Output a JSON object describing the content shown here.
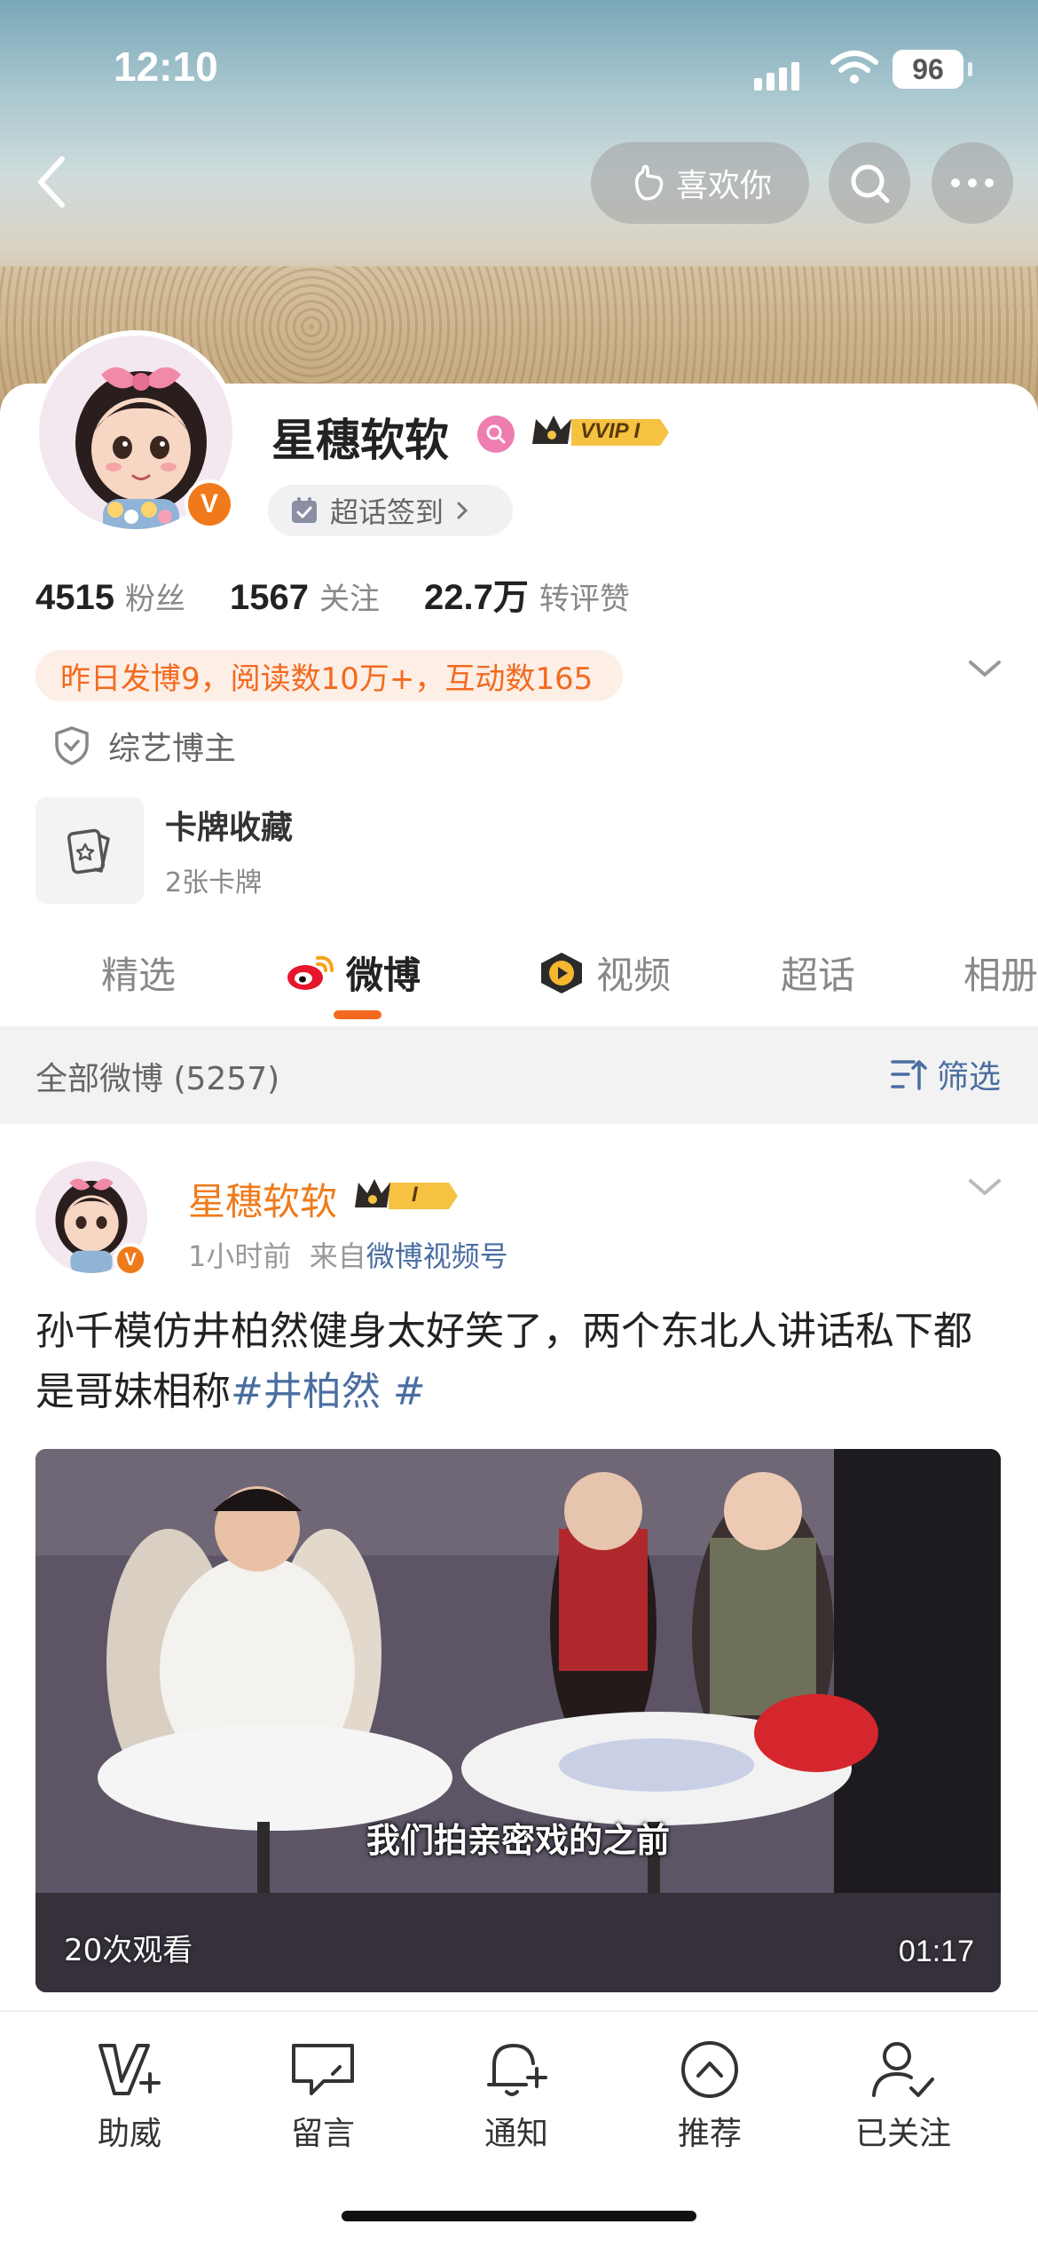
{
  "status_bar": {
    "time": "12:10",
    "battery": "96"
  },
  "header": {
    "like_button_label": "喜欢你"
  },
  "profile": {
    "name": "星穗软软",
    "vip_label": "VVIP I",
    "verified_badge": "V",
    "chaohua_label": "超话签到",
    "stats": [
      {
        "value": "4515",
        "label": "粉丝"
      },
      {
        "value": "1567",
        "label": "关注"
      },
      {
        "value": "22.7万",
        "label": "转评赞"
      }
    ],
    "activity": "昨日发博9，阅读数10万+，互动数165",
    "tag": "综艺博主",
    "cards": {
      "title": "卡牌收藏",
      "subtitle": "2张卡牌"
    }
  },
  "tabs": [
    {
      "label": "精选",
      "active": false
    },
    {
      "label": "微博",
      "active": true
    },
    {
      "label": "视频",
      "active": false
    },
    {
      "label": "超话",
      "active": false
    },
    {
      "label": "相册",
      "active": false
    }
  ],
  "filter": {
    "count_label": "全部微博 (5257)",
    "button_label": "筛选"
  },
  "post": {
    "author": "星穗软软",
    "vip_label": "I",
    "time": "1小时前",
    "from_prefix": "来自",
    "source": "微博视频号",
    "text": "孙千模仿井柏然健身太好笑了，两个东北人讲话私下都是哥妹相称",
    "topic": "#井柏然 #",
    "video": {
      "caption": "我们拍亲密戏的之前",
      "views": "20次观看",
      "duration": "01:17"
    }
  },
  "bottom_bar": [
    {
      "label": "助威",
      "icon": "v-plus-icon"
    },
    {
      "label": "留言",
      "icon": "chat-icon"
    },
    {
      "label": "通知",
      "icon": "bell-plus-icon"
    },
    {
      "label": "推荐",
      "icon": "chevron-up-circle-icon"
    },
    {
      "label": "已关注",
      "icon": "user-check-icon"
    }
  ],
  "colors": {
    "accent": "#f36a1e",
    "link": "#4a6ea0",
    "vip_gold": "#f5c242"
  }
}
